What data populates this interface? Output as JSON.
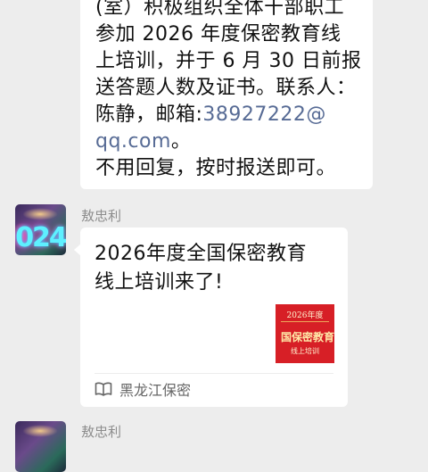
{
  "messages": [
    {
      "type": "text",
      "lines": [
        "(室）积极组织全体干部职工",
        "参加 2026 年度保密教育线",
        "上培训，并于 6 月 30 日前报",
        "送答题人数及证书。联系人：",
        "陈静，邮箱:",
        "38927222@",
        "qq.com",
        "。",
        "不用回复，按时报送即可。"
      ]
    },
    {
      "type": "article",
      "sender": "敖忠利",
      "avatar_icon": "avatar-2024-neon-icon",
      "avatar_digits": "024",
      "title": "2026年度全国保密教育线上培训来了!",
      "thumbnail": {
        "year_text": "2026年度",
        "main_text": "国保密教育",
        "sub_text": "线上培训",
        "background": "#d71f26"
      },
      "source_icon": "book-icon",
      "source_name": "黑龙江保密"
    },
    {
      "type": "partial",
      "sender": "敖忠利"
    }
  ],
  "colors": {
    "background": "#ededed",
    "bubble": "#ffffff",
    "link": "#576b95",
    "sender_text": "#8c8c8c"
  }
}
